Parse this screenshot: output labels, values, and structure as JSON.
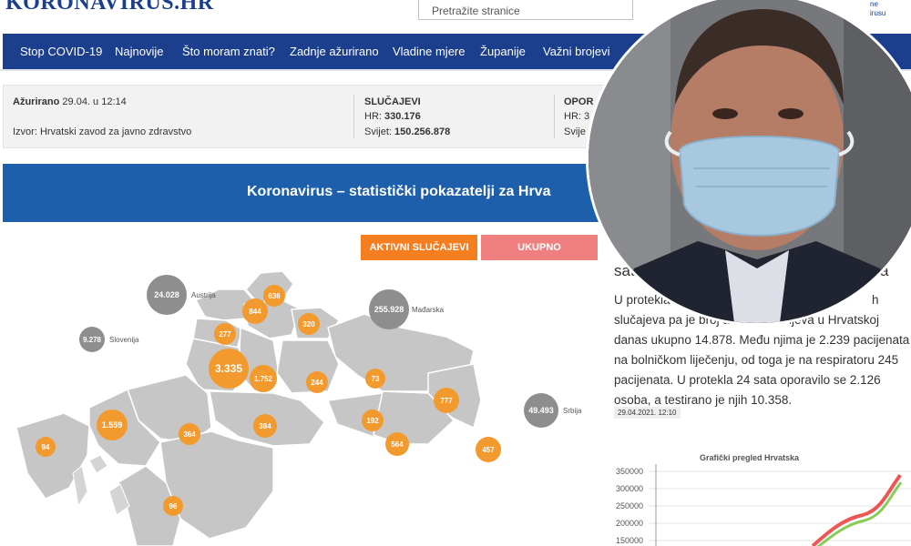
{
  "header": {
    "logo": "KORONAVIRUS.HR",
    "search_placeholder": "Pretražite stranice",
    "corner_text_1": "ne",
    "corner_text_2": "irusu"
  },
  "nav": {
    "items": [
      "Stop COVID-19",
      "Najnovije",
      "Što moram znati?",
      "Zadnje ažurirano",
      "Vladine mjere",
      "Županije",
      "Važni brojevi"
    ]
  },
  "info": {
    "updated_label": "Ažurirano",
    "updated_value": "29.04. u 12:14",
    "source": "Izvor: Hrvatski zavod za javno zdravstvo",
    "cases_title": "SLUČAJEVI",
    "hr_label": "HR:",
    "hr_value": "330.176",
    "world_label": "Svijet:",
    "world_value": "150.256.878",
    "recovered_title_partial": "OPOR",
    "recovered_hr_partial": "HR: 3",
    "recovered_world_partial": "Svije"
  },
  "banner": {
    "title": "Koronavirus – statistički pokazatelji za Hrva"
  },
  "buttons": {
    "active": "AKTIVNI SLUČAJEVI",
    "total": "UKUPNO"
  },
  "map": {
    "neighbors": [
      {
        "value": "24.028",
        "name": "Austrija"
      },
      {
        "value": "255.928",
        "name": "Mađarska"
      },
      {
        "value": "9.278",
        "name": "Slovenija"
      },
      {
        "value": "49.493",
        "name": "Srbija"
      }
    ],
    "counties": [
      "636",
      "844",
      "320",
      "277",
      "3.335",
      "1.752",
      "244",
      "73",
      "777",
      "1.559",
      "364",
      "384",
      "192",
      "564",
      "457",
      "94",
      "96"
    ]
  },
  "article": {
    "headline_fragment": "sat",
    "headline_end": "a",
    "lines": [
      "U protekla 2",
      "slučajeva pa je broj a",
      "danas ukupno 14.878. Među njima je 2.239 pacijenata",
      "na bolničkom liječenju, od toga je na respiratoru 245",
      "pacijenata. U protekla 24 sata oporavilo se 2.126",
      "osoba, a testirano je njih 10.358."
    ],
    "line1_tail": "h",
    "line2_tail": "ljeva u Hrvatskoj",
    "timestamp": "29.04.2021. 12:10"
  },
  "chart_data": {
    "type": "line",
    "title": "Grafički pregled Hrvatska",
    "yticks": [
      "350000",
      "300000",
      "250000",
      "200000",
      "150000"
    ],
    "ylim": [
      150000,
      350000
    ],
    "series": [
      {
        "color": "#ee5555"
      },
      {
        "color": "#88cc55"
      }
    ]
  },
  "colors": {
    "brand": "#1b3f8c",
    "banner": "#1e5fab",
    "active_button": "#f47e20",
    "total_button": "#f08080",
    "bubble_orange": "#f39a2e",
    "bubble_grey": "#8e8e8e"
  }
}
